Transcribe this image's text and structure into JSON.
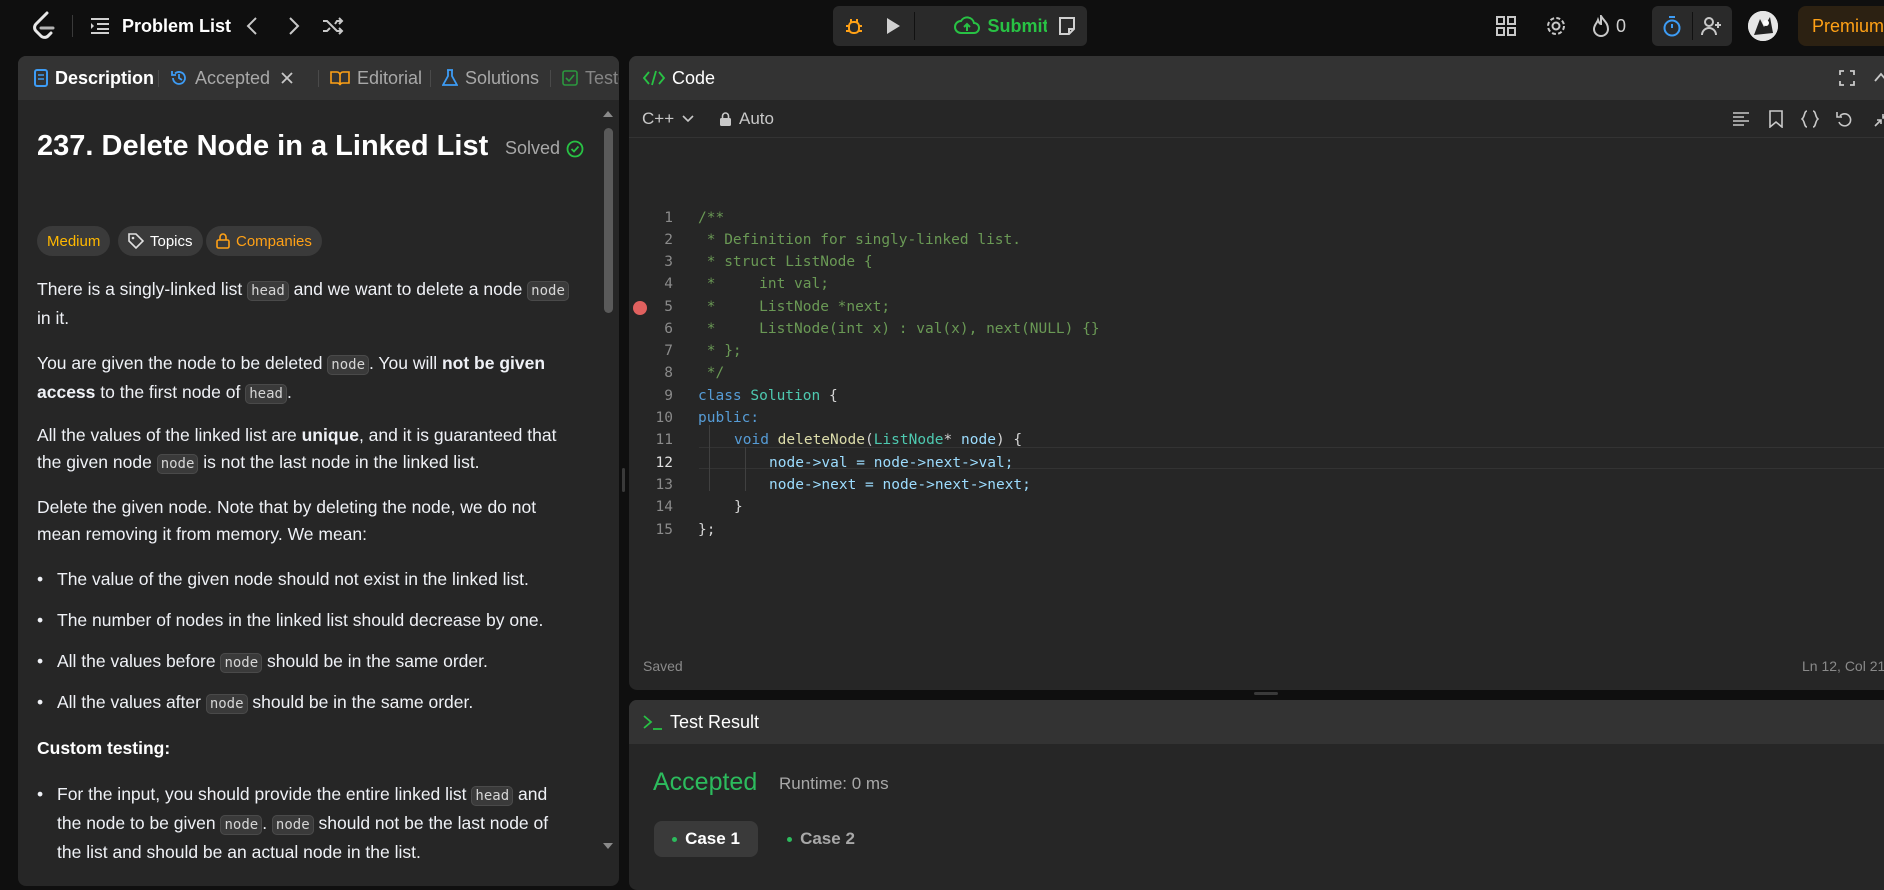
{
  "topbar": {
    "problem_list_label": "Problem List",
    "submit_label": "Submit",
    "streak_count": "0",
    "premium_label": "Premium"
  },
  "left_panel": {
    "tabs": [
      {
        "label": "Description"
      },
      {
        "label": "Accepted"
      },
      {
        "label": "Editorial"
      },
      {
        "label": "Solutions"
      },
      {
        "label": "Testc"
      }
    ],
    "title": "237. Delete Node in a Linked List",
    "solved_label": "Solved",
    "chips": {
      "difficulty": "Medium",
      "topics": "Topics",
      "companies": "Companies"
    },
    "p1": {
      "a": "There is a singly-linked list ",
      "c1": "head",
      "b": " and we want to delete a node ",
      "c2": "node",
      "c": " in it."
    },
    "p2": {
      "a": "You are given the node to be deleted ",
      "c1": "node",
      "b": ". You will ",
      "bold": "not be given access",
      "c": " to the first node of ",
      "c2": "head",
      "d": "."
    },
    "p3": {
      "a": "All the values of the linked list are ",
      "bold": "unique",
      "b": ", and it is guaranteed that the given node ",
      "c1": "node",
      "c": " is not the last node in the linked list."
    },
    "p4": {
      "a": "Delete the given node. Note that by deleting the node, we do not mean removing it from memory. We mean:"
    },
    "bullets": {
      "b1": "The value of the given node should not exist in the linked list.",
      "b2": "The number of nodes in the linked list should decrease by one.",
      "b3a": "All the values before ",
      "b3c": "node",
      "b3b": " should be in the same order.",
      "b4a": "All the values after ",
      "b4c": "node",
      "b4b": " should be in the same order."
    },
    "custom_testing_label": "Custom testing:",
    "ct": {
      "a": "For the input, you should provide the entire linked list ",
      "c1": "head",
      "b": " and the node to be given ",
      "c2": "node",
      "c": ". ",
      "c3": "node",
      "d": " should not be the last node of the list and should be an actual node in the list."
    }
  },
  "code_panel": {
    "title": "Code",
    "language": "C++",
    "mode": "Auto",
    "status_left": "Saved",
    "status_right": "Ln 12, Col 21",
    "line_numbers": [
      "1",
      "2",
      "3",
      "4",
      "5",
      "6",
      "7",
      "8",
      "9",
      "10",
      "11",
      "12",
      "13",
      "14",
      "15"
    ],
    "lines": {
      "l1": "/**",
      "l2": " * Definition for singly-linked list.",
      "l3": " * struct ListNode {",
      "l4": " *     int val;",
      "l5": " *     ListNode *next;",
      "l6": " *     ListNode(int x) : val(x), next(NULL) {}",
      "l7": " * };",
      "l8": " */",
      "l9_kw": "class",
      "l9_ty": "Solution",
      "l9_pl": " {",
      "l10_kw": "public:",
      "l11_kw": "void",
      "l11_fn": "deleteNode",
      "l11_p1": "(",
      "l11_ty": "ListNode",
      "l11_p2": "* ",
      "l11_vr": "node",
      "l11_p3": ") {",
      "l12": "node->val = node->next->val;",
      "l13": "node->next = node->next->next;",
      "l14": "}",
      "l15": "};"
    }
  },
  "test_panel": {
    "title": "Test Result",
    "verdict": "Accepted",
    "runtime": "Runtime: 0 ms",
    "cases": [
      "Case 1",
      "Case 2"
    ]
  }
}
